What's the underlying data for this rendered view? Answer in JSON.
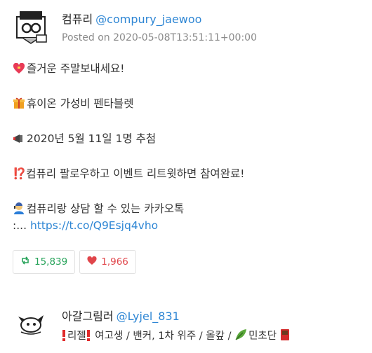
{
  "tweet1": {
    "display_name": "컴퓨리",
    "handle": "@compury_jaewoo",
    "posted": "Posted on 2020-05-08T13:51:11+00:00",
    "lines": [
      "즐거운 주말보내세요!",
      "휴이온 가성비 펜타블렛",
      "2020년 5월 11일 1명 추첨",
      "⁉️컴퓨리 팔로우하고 이벤트 리트윗하면 참여완료!",
      "컴퓨리랑 상담 할 수 있는 카카오톡"
    ],
    "last_prefix": ":...",
    "link": "https://t.co/Q9Esjq4vho",
    "retweets": "15,839",
    "likes": "1,966"
  },
  "tweet2": {
    "display_name": "아갈그림러",
    "handle": "@Lyjel_831",
    "bio_a": "리젤",
    "bio_b": "여고생 / 밴커, 1차 위주 / 올캎 /",
    "bio_c": "민초단"
  },
  "colors": {
    "link": "#2e86d4",
    "retweet": "#27a35a",
    "like": "#e0454a"
  }
}
